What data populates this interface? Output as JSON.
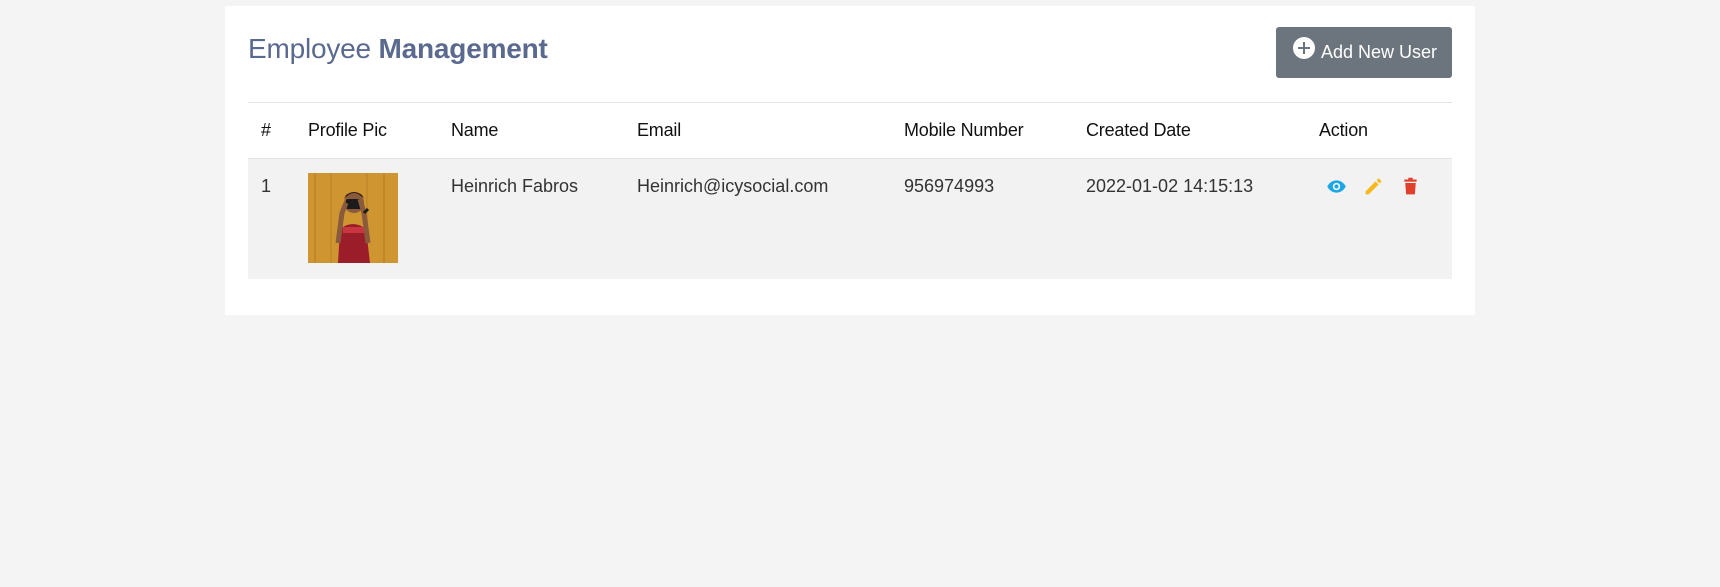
{
  "header": {
    "title_light": "Employee",
    "title_bold": "Management",
    "add_button_label": "Add New User"
  },
  "table": {
    "columns": [
      "#",
      "Profile Pic",
      "Name",
      "Email",
      "Mobile Number",
      "Created Date",
      "Action"
    ],
    "rows": [
      {
        "index": "1",
        "name": "Heinrich Fabros",
        "email": "Heinrich@icysocial.com",
        "mobile": "956974993",
        "created": "2022-01-02 14:15:13"
      }
    ]
  },
  "icons": {
    "add": "plus-circle-icon",
    "view": "eye-icon",
    "edit": "pencil-icon",
    "delete": "trash-icon"
  },
  "colors": {
    "background": "#f4f4f4",
    "title": "#5a6a8f",
    "button": "#6c757d",
    "view": "#1ba7e6",
    "edit": "#f6b81a",
    "delete": "#e0402b"
  }
}
